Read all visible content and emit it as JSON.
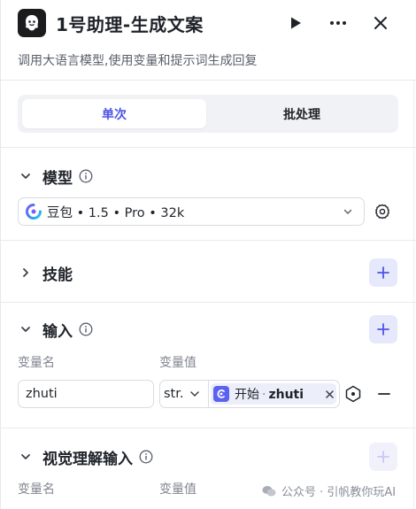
{
  "header": {
    "title": "1号助理-生成文案",
    "description": "调用大语言模型,使用变量和提示词生成回复"
  },
  "tabs": [
    {
      "label": "单次",
      "active": true
    },
    {
      "label": "批处理",
      "active": false
    }
  ],
  "sections": {
    "model": {
      "title": "模型",
      "selected_model": "豆包 • 1.5 • Pro • 32k"
    },
    "skills": {
      "title": "技能"
    },
    "input": {
      "title": "输入",
      "col_name": "变量名",
      "col_value": "变量值",
      "rows": [
        {
          "name": "zhuti",
          "type": "str.",
          "ref_node": "开始",
          "ref_sep": "·",
          "ref_var": "zhuti"
        }
      ]
    },
    "visual_input": {
      "title": "视觉理解输入",
      "col_name": "变量名",
      "col_value": "变量值"
    }
  },
  "watermark": {
    "text": "公众号 · 引帆教你玩AI"
  },
  "colors": {
    "accent": "#4d53e8",
    "accent_bg": "#e6e8fb",
    "tag_bg": "#eceef9",
    "text": "#1f2329",
    "muted": "#80858f"
  },
  "icons": [
    "app-logo-icon",
    "play-icon",
    "more-icon",
    "close-icon",
    "chevron-down-icon",
    "chevron-right-icon",
    "info-icon",
    "plus-icon",
    "settings-icon",
    "variable-icon",
    "minus-icon",
    "start-node-icon",
    "wechat-icon"
  ]
}
